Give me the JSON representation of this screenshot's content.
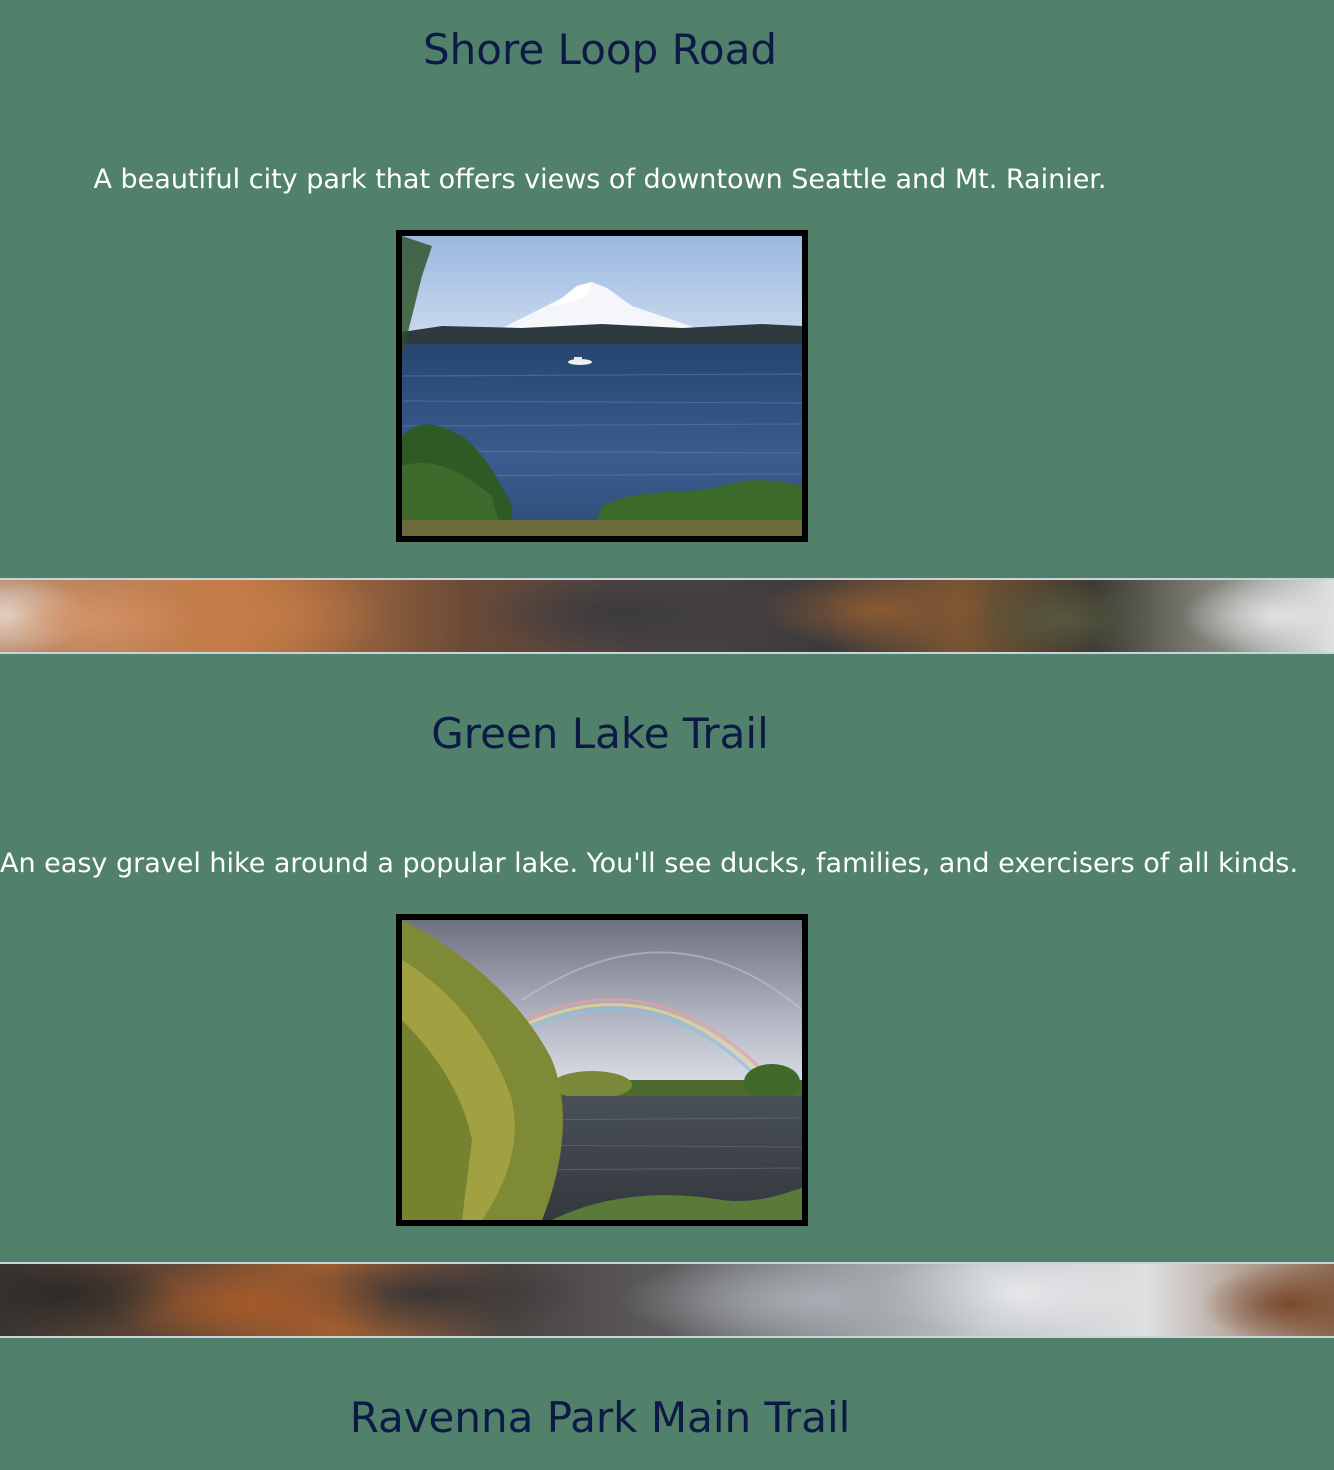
{
  "trails": [
    {
      "title": "Shore Loop Road",
      "description": "A beautiful city park that offers views of downtown Seattle and Mt. Rainier.",
      "photo_subject": "mountain-lake-photo"
    },
    {
      "title": "Green Lake Trail",
      "description": "An easy gravel hike around a popular lake. You'll see ducks, families, and exercisers of all kinds.",
      "photo_subject": "rainbow-lake-photo"
    },
    {
      "title": "Ravenna Park Main Trail"
    }
  ],
  "colors": {
    "background": "#51816a",
    "title": "#0c1a45",
    "description": "#ffffff",
    "frame": "#000000"
  }
}
